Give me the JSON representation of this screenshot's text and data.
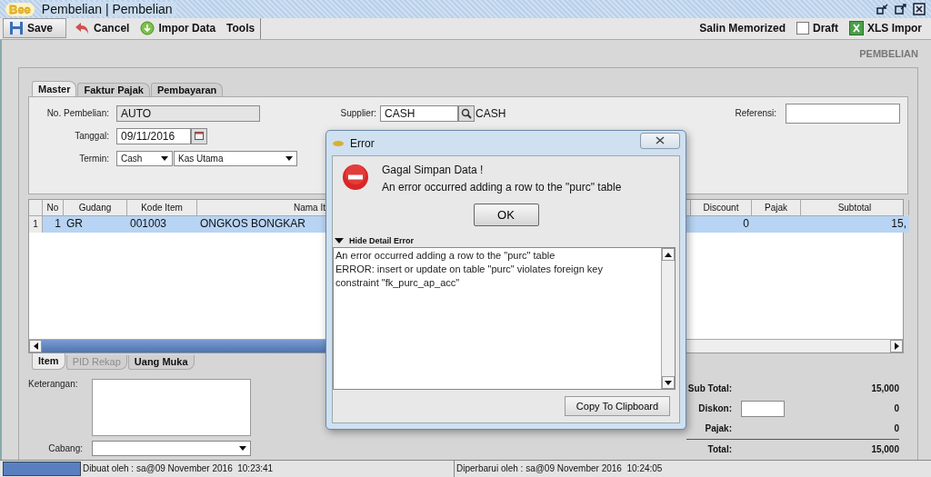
{
  "window": {
    "logo": "Bee",
    "title": "Pembelian | Pembelian"
  },
  "toolbar": {
    "buttons": [
      {
        "label": "Save",
        "kind": "save"
      },
      {
        "label": "Cancel",
        "kind": "cancel"
      },
      {
        "label": "Impor Data",
        "kind": "import"
      },
      {
        "label": "Tools",
        "kind": "text"
      }
    ],
    "memorized": "Salin Memorized",
    "draft": {
      "label": "Draft",
      "checked": false
    },
    "xls": "XLS Impor"
  },
  "page_title": "PEMBELIAN",
  "tabs": [
    {
      "label": "Master",
      "selected": true
    },
    {
      "label": "Faktur Pajak",
      "selected": false
    },
    {
      "label": "Pembayaran",
      "selected": false
    }
  ],
  "form": {
    "no_label": "No. Pembelian:",
    "no_value": "AUTO",
    "date_label": "Tanggal:",
    "date_value": "09/11/2016",
    "term_label": "Termin:",
    "term_value": "Cash",
    "account_value": "Kas Utama",
    "supplier_label": "Supplier:",
    "supplier_value": "CASH",
    "supplier_name": "CASH",
    "ref_label": "Referensi:"
  },
  "table": {
    "columns": [
      "No",
      "Gudang",
      "Kode Item",
      "Nama It",
      "Discount",
      "Pajak",
      "Subtotal"
    ],
    "rows": [
      {
        "index": "1",
        "selected": true,
        "cells": [
          "1",
          "GR",
          "001003",
          "ONGKOS BONGKAR",
          "0",
          "",
          "15,"
        ]
      }
    ]
  },
  "bottom_tabs": [
    {
      "label": "Item",
      "selected": true,
      "disabled": false
    },
    {
      "label": "PID Rekap",
      "selected": false,
      "disabled": true
    },
    {
      "label": "Uang Muka",
      "selected": false,
      "disabled": false
    }
  ],
  "notes_label": "Keterangan:",
  "branch_label": "Cabang:",
  "summary": [
    {
      "label": "Sub Total:",
      "value": "15,000",
      "kind": "text"
    },
    {
      "label": "Diskon:",
      "value": "0",
      "kind": "input"
    },
    {
      "label": "Pajak:",
      "value": "0",
      "kind": "text"
    },
    {
      "label": "Total:",
      "value": "15,000",
      "kind": "total"
    }
  ],
  "status_bar": {
    "created": "Dibuat oleh : sa@09 November 2016  10:23:41",
    "updated": "Diperbarui oleh : sa@09 November 2016  10:24:05"
  },
  "dialog": {
    "title": "Error",
    "heading": "Gagal Simpan Data !",
    "message": "An error occurred adding a row to the \"purc\" table",
    "ok": "OK",
    "toggle": "Hide Detail Error",
    "detail": "An error occurred adding a row to the \"purc\" table\nERROR: insert or update on table \"purc\" violates foreign key\nconstraint \"fk_purc_ap_acc\"",
    "copy": "Copy To Clipboard"
  }
}
